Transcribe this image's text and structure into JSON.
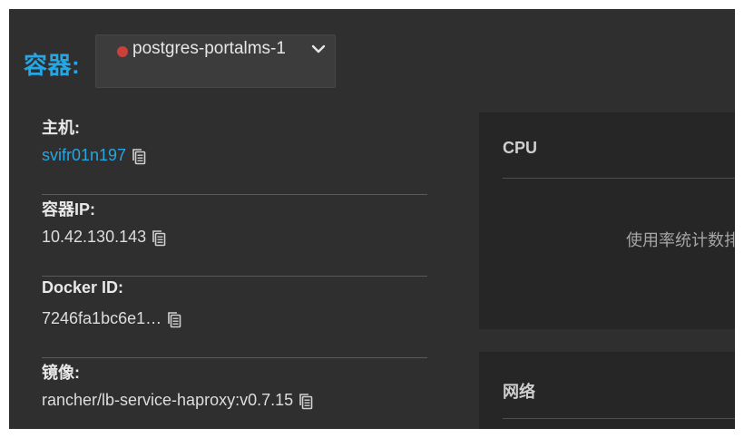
{
  "header": {
    "label": "容器:",
    "container_select": {
      "value": "postgres-portalms-1",
      "status_color": "#c9413a"
    }
  },
  "info": {
    "host": {
      "label": "主机:",
      "value": "svifr01n197"
    },
    "container_ip": {
      "label": "容器IP:",
      "value": "10.42.130.143"
    },
    "docker_id": {
      "label": "Docker ID:",
      "value": "7246fa1bc6e1…"
    },
    "image": {
      "label": "镜像:",
      "value": "rancher/lb-service-haproxy:v0.7.15"
    }
  },
  "panels": {
    "cpu": {
      "title": "CPU",
      "message": "使用率统计数排"
    },
    "network": {
      "title": "网络"
    }
  },
  "colors": {
    "accent": "#25a6e5",
    "background": "#2f2f2f",
    "panel": "#262626",
    "status_stopped": "#c9413a"
  },
  "icons": {
    "copy": "clipboard-icon",
    "dropdown": "chevron-down-icon",
    "status": "status-dot"
  }
}
